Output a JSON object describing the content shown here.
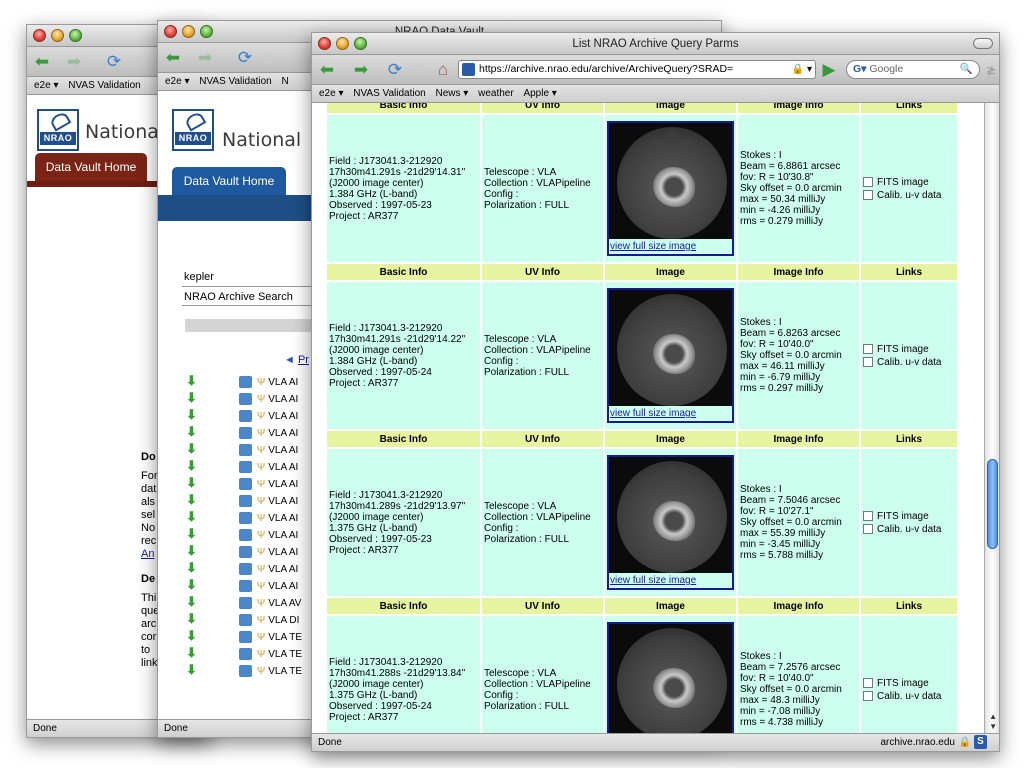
{
  "window1": {
    "status": "Done",
    "bookmarks": [
      "e2e ▾",
      "NVAS Validation"
    ],
    "site_name": "Nationa",
    "tab": "Data Vault Home",
    "side_texts": [
      "Do",
      "For",
      "dat",
      "als",
      "sel",
      "No",
      "rec",
      "An",
      "De",
      "Thi",
      "que",
      "arc",
      "cor",
      "to ",
      "link"
    ]
  },
  "window2": {
    "title": "NRAO Data Vault",
    "status": "Done",
    "bookmarks": [
      "e2e ▾",
      "NVAS Validation",
      "N"
    ],
    "site_name": "National",
    "tab": "Data Vault Home",
    "search_value": "kepler",
    "search_select": "NRAO Archive Search",
    "pager_label": "Pr",
    "list_items": [
      "VLA AI",
      "VLA AI",
      "VLA AI",
      "VLA AI",
      "VLA AI",
      "VLA AI",
      "VLA AI",
      "VLA AI",
      "VLA AI",
      "VLA AI",
      "VLA AI",
      "VLA AI",
      "VLA AI",
      "VLA AV",
      "VLA DI",
      "VLA TE",
      "VLA TE",
      "VLA TE"
    ]
  },
  "window3": {
    "title": "List NRAO Archive Query Parms",
    "url": "https://archive.nrao.edu/archive/ArchiveQuery?SRAD=",
    "search_engine": "Google",
    "bookmarks": [
      "e2e ▾",
      "NVAS Validation",
      "News ▾",
      "weather",
      "Apple ▾"
    ],
    "status": "Done",
    "status_right": "archive.nrao.edu",
    "headers": [
      "Basic Info",
      "UV Info",
      "Image",
      "Image Info",
      "Links"
    ],
    "view_link": "view full size image",
    "link_labels": [
      "FITS image",
      "Calib. u-v data"
    ],
    "rows": [
      {
        "basic": "Field : J173041.3-212920\n17h30m41.291s -21d29'14.31\"\n(J2000 image center)\n1.384 GHz (L-band)\nObserved : 1997-05-23\nProject : AR377",
        "uv": "Telescope : VLA\nCollection : VLAPipeline\nConfig :\nPolarization : FULL",
        "info": "Stokes : I\nBeam = 6.8861 arcsec\nfov: R = 10'30.8\"\nSky offset = 0.0 arcmin\nmax = 50.34 milliJy\nmin = -4.26 milliJy\nrms = 0.279 milliJy"
      },
      {
        "basic": "Field : J173041.3-212920\n17h30m41.291s -21d29'14.22\"\n(J2000 image center)\n1.384 GHz (L-band)\nObserved : 1997-05-24\nProject : AR377",
        "uv": "Telescope : VLA\nCollection : VLAPipeline\nConfig :\nPolarization : FULL",
        "info": "Stokes : I\nBeam = 6.8263 arcsec\nfov: R = 10'40.0\"\nSky offset = 0.0 arcmin\nmax = 46.11 milliJy\nmin = -6.79 milliJy\nrms = 0.297 milliJy"
      },
      {
        "basic": "Field : J173041.3-212920\n17h30m41.289s -21d29'13.97\"\n(J2000 image center)\n1.375 GHz (L-band)\nObserved : 1997-05-23\nProject : AR377",
        "uv": "Telescope : VLA\nCollection : VLAPipeline\nConfig :\nPolarization : FULL",
        "info": "Stokes : I\nBeam = 7.5046 arcsec\nfov: R = 10'27.1\"\nSky offset = 0.0 arcmin\nmax = 55.39 milliJy\nmin = -3.45 milliJy\nrms = 5.788 milliJy"
      },
      {
        "basic": "Field : J173041.3-212920\n17h30m41.288s -21d29'13.84\"\n(J2000 image center)\n1.375 GHz (L-band)\nObserved : 1997-05-24\nProject : AR377",
        "uv": "Telescope : VLA\nCollection : VLAPipeline\nConfig :\nPolarization : FULL",
        "info": "Stokes : I\nBeam = 7.2576 arcsec\nfov: R = 10'40.0\"\nSky offset = 0.0 arcmin\nmax = 48.3 milliJy\nmin = -7.08 milliJy\nrms = 4.738 milliJy"
      }
    ]
  }
}
